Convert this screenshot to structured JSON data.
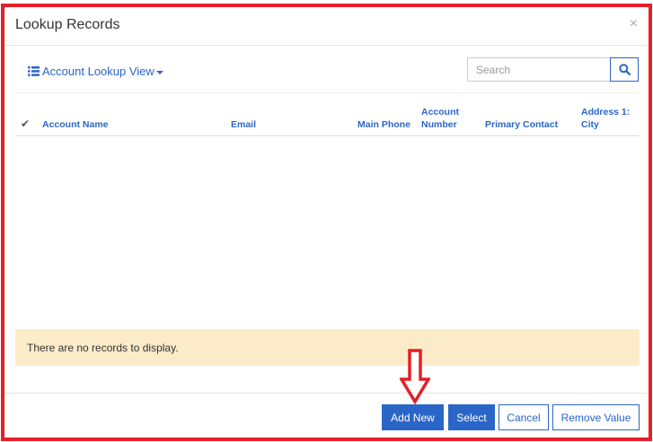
{
  "dialog": {
    "title": "Lookup Records",
    "close_glyph": "×"
  },
  "toolbar": {
    "view_label": "Account Lookup View",
    "search_placeholder": "Search"
  },
  "table": {
    "columns": [
      {
        "label": "Account Name"
      },
      {
        "label": "Email"
      },
      {
        "label": "Main Phone"
      },
      {
        "label": "Account Number"
      },
      {
        "label": "Primary Contact"
      },
      {
        "label": "Address 1: City"
      }
    ],
    "empty_message": "There are no records to display."
  },
  "footer": {
    "add_new_label": "Add New",
    "select_label": "Select",
    "cancel_label": "Cancel",
    "remove_label": "Remove Value"
  },
  "colors": {
    "accent": "#2a66c8",
    "annotation_red": "#e3202a",
    "empty_background": "#fcebc8"
  },
  "icons": {
    "view": "list-icon",
    "search": "search-icon",
    "select_all": "checkmark-icon",
    "annotation": "down-arrow-icon"
  }
}
